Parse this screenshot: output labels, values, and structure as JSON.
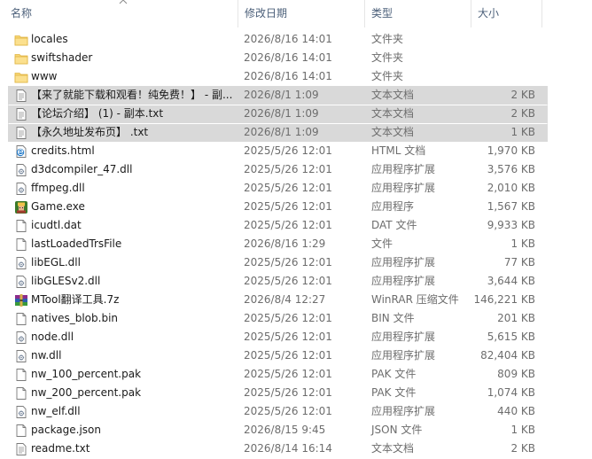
{
  "columns": {
    "name": "名称",
    "date": "修改日期",
    "type": "类型",
    "size": "大小"
  },
  "files": [
    {
      "name": "locales",
      "date": "2026/8/16 14:01",
      "type": "文件夹",
      "size": "",
      "icon": "folder-icon",
      "selected": false
    },
    {
      "name": "swiftshader",
      "date": "2026/8/16 14:01",
      "type": "文件夹",
      "size": "",
      "icon": "folder-icon",
      "selected": false
    },
    {
      "name": "www",
      "date": "2026/8/16 14:01",
      "type": "文件夹",
      "size": "",
      "icon": "folder-icon",
      "selected": false
    },
    {
      "name": "【来了就能下载和观看！纯免费！】 - 副...",
      "date": "2026/8/1 1:09",
      "type": "文本文档",
      "size": "2 KB",
      "icon": "text-file-icon",
      "selected": true
    },
    {
      "name": "【论坛介绍】 (1) - 副本.txt",
      "date": "2026/8/1 1:09",
      "type": "文本文档",
      "size": "2 KB",
      "icon": "text-file-icon",
      "selected": true
    },
    {
      "name": "【永久地址发布页】 .txt",
      "date": "2026/8/1 1:09",
      "type": "文本文档",
      "size": "1 KB",
      "icon": "text-file-icon",
      "selected": true
    },
    {
      "name": "credits.html",
      "date": "2025/5/26 12:01",
      "type": "HTML 文档",
      "size": "1,970 KB",
      "icon": "html-file-icon",
      "selected": false
    },
    {
      "name": "d3dcompiler_47.dll",
      "date": "2025/5/26 12:01",
      "type": "应用程序扩展",
      "size": "3,576 KB",
      "icon": "dll-file-icon",
      "selected": false
    },
    {
      "name": "ffmpeg.dll",
      "date": "2025/5/26 12:01",
      "type": "应用程序扩展",
      "size": "2,010 KB",
      "icon": "dll-file-icon",
      "selected": false
    },
    {
      "name": "Game.exe",
      "date": "2025/5/26 12:01",
      "type": "应用程序",
      "size": "1,567 KB",
      "icon": "game-exe-icon",
      "selected": false
    },
    {
      "name": "icudtl.dat",
      "date": "2025/5/26 12:01",
      "type": "DAT 文件",
      "size": "9,933 KB",
      "icon": "blank-file-icon",
      "selected": false
    },
    {
      "name": "lastLoadedTrsFile",
      "date": "2026/8/16 1:29",
      "type": "文件",
      "size": "1 KB",
      "icon": "blank-file-icon",
      "selected": false
    },
    {
      "name": "libEGL.dll",
      "date": "2025/5/26 12:01",
      "type": "应用程序扩展",
      "size": "77 KB",
      "icon": "dll-file-icon",
      "selected": false
    },
    {
      "name": "libGLESv2.dll",
      "date": "2025/5/26 12:01",
      "type": "应用程序扩展",
      "size": "3,644 KB",
      "icon": "dll-file-icon",
      "selected": false
    },
    {
      "name": "MTool翻译工具.7z",
      "date": "2026/8/4 12:27",
      "type": "WinRAR 压缩文件",
      "size": "146,221 KB",
      "icon": "winrar-archive-icon",
      "selected": false
    },
    {
      "name": "natives_blob.bin",
      "date": "2025/5/26 12:01",
      "type": "BIN 文件",
      "size": "201 KB",
      "icon": "blank-file-icon",
      "selected": false
    },
    {
      "name": "node.dll",
      "date": "2025/5/26 12:01",
      "type": "应用程序扩展",
      "size": "5,615 KB",
      "icon": "dll-file-icon",
      "selected": false
    },
    {
      "name": "nw.dll",
      "date": "2025/5/26 12:01",
      "type": "应用程序扩展",
      "size": "82,404 KB",
      "icon": "dll-file-icon",
      "selected": false
    },
    {
      "name": "nw_100_percent.pak",
      "date": "2025/5/26 12:01",
      "type": "PAK 文件",
      "size": "809 KB",
      "icon": "blank-file-icon",
      "selected": false
    },
    {
      "name": "nw_200_percent.pak",
      "date": "2025/5/26 12:01",
      "type": "PAK 文件",
      "size": "1,074 KB",
      "icon": "blank-file-icon",
      "selected": false
    },
    {
      "name": "nw_elf.dll",
      "date": "2025/5/26 12:01",
      "type": "应用程序扩展",
      "size": "440 KB",
      "icon": "dll-file-icon",
      "selected": false
    },
    {
      "name": "package.json",
      "date": "2026/8/15 9:45",
      "type": "JSON 文件",
      "size": "1 KB",
      "icon": "blank-file-icon",
      "selected": false
    },
    {
      "name": "readme.txt",
      "date": "2026/8/14 16:14",
      "type": "文本文档",
      "size": "2 KB",
      "icon": "text-file-icon",
      "selected": false
    }
  ]
}
